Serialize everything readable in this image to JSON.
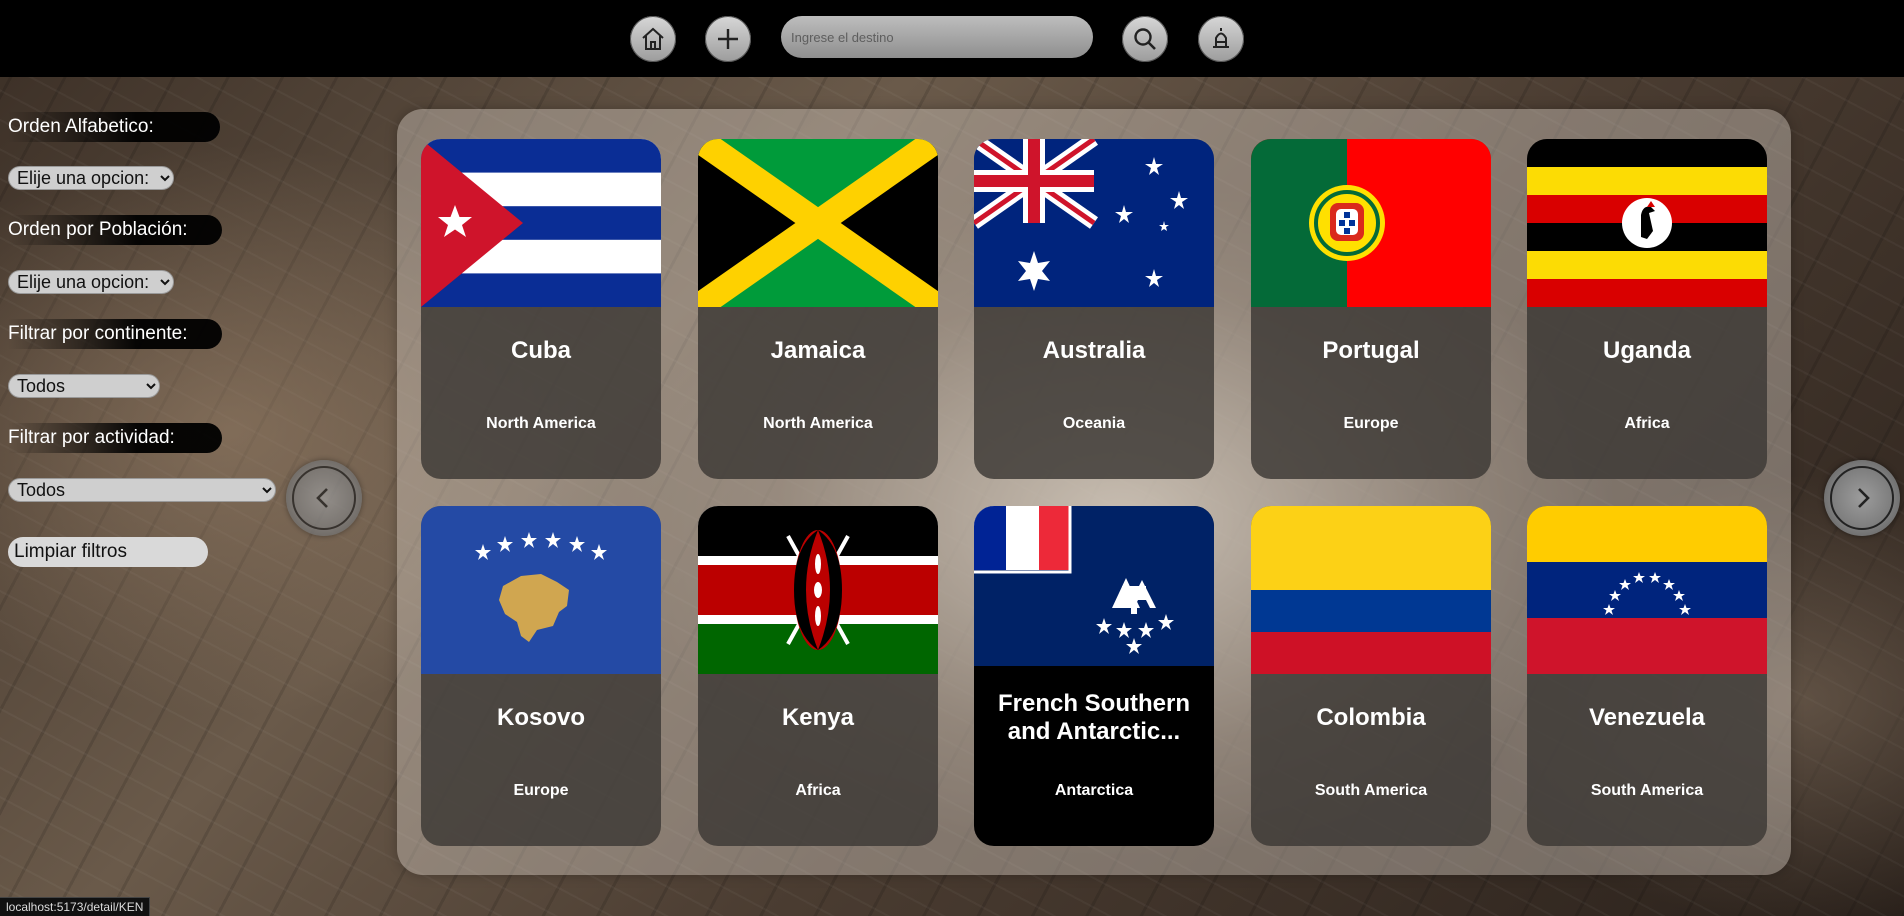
{
  "topbar": {
    "search_placeholder": "Ingrese el destino",
    "icons": [
      "home-icon",
      "plus-icon",
      "search-icon",
      "activity-icon"
    ]
  },
  "filters": {
    "alpha_label": "Orden Alfabetico:",
    "alpha_value": "Elije una opcion:",
    "population_label": "Orden por Población:",
    "population_value": "Elije una opcion:",
    "continent_label": "Filtrar por continente:",
    "continent_value": "Todos",
    "activity_label": "Filtrar por actividad:",
    "activity_value": "Todos",
    "clear_label": "Limpiar filtros"
  },
  "countries": [
    {
      "name": "Cuba",
      "continent": "North America"
    },
    {
      "name": "Jamaica",
      "continent": "North America"
    },
    {
      "name": "Australia",
      "continent": "Oceania"
    },
    {
      "name": "Portugal",
      "continent": "Europe"
    },
    {
      "name": "Uganda",
      "continent": "Africa"
    },
    {
      "name": "Kosovo",
      "continent": "Europe"
    },
    {
      "name": "Kenya",
      "continent": "Africa"
    },
    {
      "name": "French Southern and Antarctic...",
      "continent": "Antarctica"
    },
    {
      "name": "Colombia",
      "continent": "South America"
    },
    {
      "name": "Venezuela",
      "continent": "South America"
    }
  ],
  "status_url": "localhost:5173/detail/KEN"
}
